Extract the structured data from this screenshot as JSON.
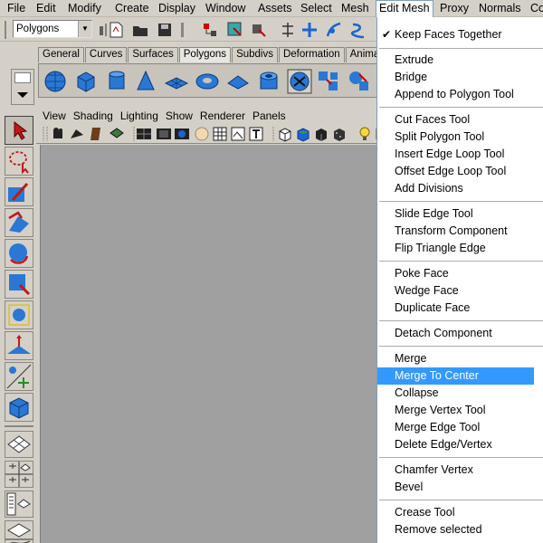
{
  "menubar": {
    "items": [
      "File",
      "Edit",
      "Modify",
      "Create",
      "Display",
      "Window",
      "Assets",
      "Select",
      "Mesh",
      "Edit Mesh",
      "Proxy",
      "Normals",
      "Co"
    ],
    "active": "Edit Mesh"
  },
  "status": {
    "mode_value": "Polygons"
  },
  "shelf": {
    "tabs": [
      "General",
      "Curves",
      "Surfaces",
      "Polygons",
      "Subdivs",
      "Deformation",
      "Animation"
    ],
    "active_tab": "Polygons"
  },
  "panel": {
    "menus": [
      "View",
      "Shading",
      "Lighting",
      "Show",
      "Renderer",
      "Panels"
    ]
  },
  "dropdown": {
    "check_item": "Keep Faces Together",
    "groups": [
      [
        "Extrude",
        "Bridge",
        "Append to Polygon Tool"
      ],
      [
        "Cut Faces Tool",
        "Split Polygon Tool",
        "Insert Edge Loop Tool",
        "Offset Edge Loop Tool",
        "Add Divisions"
      ],
      [
        "Slide Edge Tool",
        "Transform Component",
        "Flip Triangle Edge"
      ],
      [
        "Poke Face",
        "Wedge Face",
        "Duplicate Face"
      ],
      [
        "Detach Component"
      ],
      [
        "Merge",
        "Merge To Center",
        "Collapse",
        "Merge Vertex Tool",
        "Merge Edge Tool",
        "Delete Edge/Vertex"
      ],
      [
        "Chamfer Vertex",
        "Bevel"
      ],
      [
        "Crease Tool",
        "Remove selected"
      ]
    ],
    "highlighted": "Merge To Center"
  },
  "colors": {
    "highlight": "#3399ff",
    "viewport": "#a0a0a0",
    "chrome": "#d4d0c8"
  }
}
